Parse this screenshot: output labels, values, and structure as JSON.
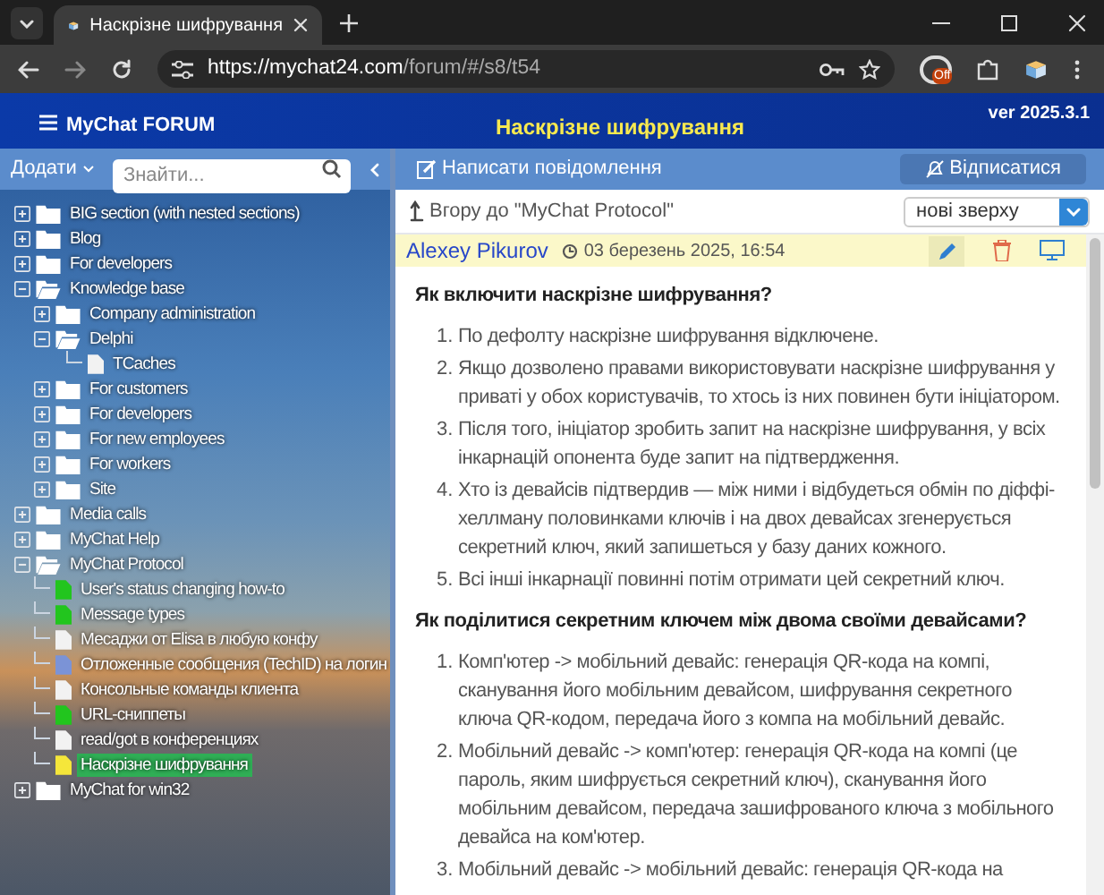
{
  "browser": {
    "tab_title": "Наскрізне шифрування",
    "url_host": "https://mychat24.com",
    "url_path": "/forum/#/s8/t54",
    "extension_badge": "Off"
  },
  "header": {
    "brand": "MyChat FORUM",
    "title": "Наскрізне шифрування",
    "version": "ver 2025.3.1"
  },
  "sidebar": {
    "add_label": "Додати",
    "search_placeholder": "Знайти...",
    "tree": [
      {
        "kind": "folder",
        "label": "BIG section (with nested sections)",
        "expanded": false,
        "selected": false
      },
      {
        "kind": "folder",
        "label": "Blog",
        "expanded": false,
        "selected": false
      },
      {
        "kind": "folder",
        "label": "For developers",
        "expanded": false,
        "selected": false
      },
      {
        "kind": "folder",
        "label": "Knowledge base",
        "expanded": true,
        "selected": false,
        "children": [
          {
            "kind": "folder",
            "label": "Company administration",
            "expanded": false,
            "selected": false
          },
          {
            "kind": "folder",
            "label": "Delphi",
            "expanded": true,
            "selected": false,
            "children": [
              {
                "kind": "page",
                "label": "TCaches",
                "color": "#f2f2f2",
                "selected": false
              }
            ]
          },
          {
            "kind": "folder",
            "label": "For customers",
            "expanded": false,
            "selected": false
          },
          {
            "kind": "folder",
            "label": "For developers",
            "expanded": false,
            "selected": false
          },
          {
            "kind": "folder",
            "label": "For new employees",
            "expanded": false,
            "selected": false
          },
          {
            "kind": "folder",
            "label": "For workers",
            "expanded": false,
            "selected": false
          },
          {
            "kind": "folder",
            "label": "Site",
            "expanded": false,
            "selected": false
          }
        ]
      },
      {
        "kind": "folder",
        "label": "Media calls",
        "expanded": false,
        "selected": false
      },
      {
        "kind": "folder",
        "label": "MyChat Help",
        "expanded": false,
        "selected": false
      },
      {
        "kind": "folder",
        "label": "MyChat Protocol",
        "expanded": true,
        "selected": false,
        "children": [
          {
            "kind": "page",
            "label": "User's status changing how-to",
            "color": "#22c51e",
            "selected": false
          },
          {
            "kind": "page",
            "label": "Message types",
            "color": "#22c51e",
            "selected": false
          },
          {
            "kind": "page",
            "label": "Месаджи от Elisa в любую конфу",
            "color": "#f2f2f2",
            "selected": false
          },
          {
            "kind": "page",
            "label": "Отложенные сообщения (TechID) на логин",
            "color": "#7b93d6",
            "selected": false
          },
          {
            "kind": "page",
            "label": "Консольные команды клиента",
            "color": "#f2f2f2",
            "selected": false
          },
          {
            "kind": "page",
            "label": "URL-сниппеты",
            "color": "#22c51e",
            "selected": false
          },
          {
            "kind": "page",
            "label": "read/got в конференциях",
            "color": "#f2f2f2",
            "selected": false
          },
          {
            "kind": "page",
            "label": "Наскрізне шифрування",
            "color": "#f5e63a",
            "selected": true
          }
        ]
      },
      {
        "kind": "folder",
        "label": "MyChat for win32",
        "expanded": false,
        "selected": false
      }
    ]
  },
  "toolbar": {
    "write_label": "Написати повідомлення",
    "unsubscribe_label": "Відписатися"
  },
  "topic": {
    "up_link": "Вгору до \"MyChat Protocol\"",
    "sort_value": "нові зверху"
  },
  "post": {
    "author": "Alexey Pikurov",
    "date": "03 березень 2025, 16:54",
    "sections": [
      {
        "heading": "Як включити наскрізне шифрування?",
        "items": [
          {
            "number": "1.",
            "text": "По дефолту наскрізне шифрування відключене."
          },
          {
            "number": "2.",
            "text": "Якщо дозволено правами використовувати наскрізне шифрування у приваті у обох користувачів, то хтось із них повинен бути ініціатором."
          },
          {
            "number": "3.",
            "text": "Після того, ініціатор зробить запит на наскрізне шифрування, у всіх інкарнацій опонента буде запит на підтвердження."
          },
          {
            "number": "4.",
            "text": "Хто із девайсів підтвердив — між ними і відбудеться обмін по діффі-хеллману половинками ключів і на двох девайсах згенерується секретний ключ, який запишеться у базу даних кожного."
          },
          {
            "number": "5.",
            "text": "Всі інші інкарнації повинні потім отримати цей секретний ключ."
          }
        ]
      },
      {
        "heading": "Як поділитися секретним ключем між двома своїми девайсами?",
        "items": [
          {
            "number": "1.",
            "text": "Комп'ютер -> мобільний девайс: генерація QR-кода на компі, сканування його мобільним девайсом, шифрування секретного ключа QR-кодом, передача його з компа на мобільний девайс."
          },
          {
            "number": "2.",
            "text": "Мобільний девайс -> комп'ютер: генерація QR-кода на компі (це пароль, яким шифрується секретний ключ), сканування його мобільним девайсом, передача зашифрованого ключа з мобільного девайса на ком'ютер."
          },
          {
            "number": "3.",
            "text": "Мобільний девайс -> мобільний девайс: генерація QR-кода на"
          }
        ]
      }
    ]
  }
}
